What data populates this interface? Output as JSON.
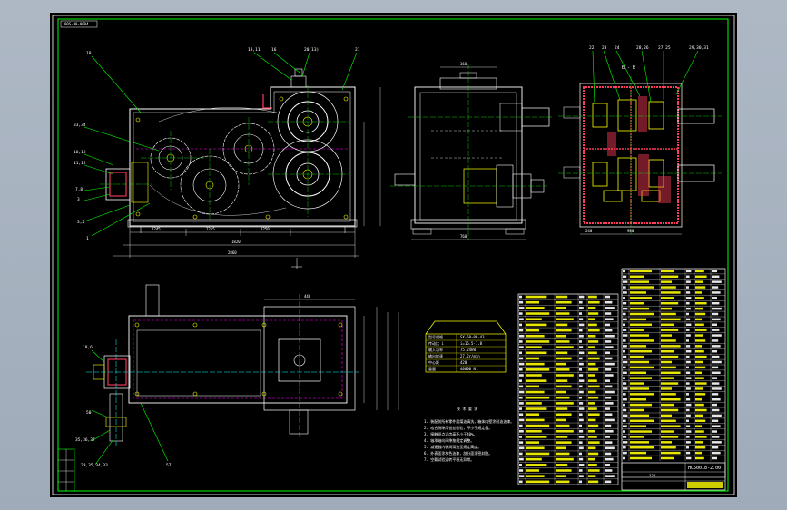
{
  "drawing": {
    "drawing_number": "00S-90-0004",
    "title_block_code": "HC50018-2.00",
    "title_block_extra": "???",
    "accent_color": "#00ff00",
    "detail_color": "#ffff00",
    "axis_color": "#00ffff",
    "section_color": "#ff3b5c",
    "housing_color": "#ff00ff"
  },
  "front_view": {
    "callouts": [
      "18",
      "33,34",
      "10,12",
      "11,12",
      "7,8",
      "3",
      "1",
      "3,2",
      "18,11",
      "16",
      "20(13)",
      "21"
    ],
    "dims_bottom": [
      "1245",
      "1245",
      "1250",
      "1820",
      "2860"
    ]
  },
  "side_view": {
    "dims": [
      "360",
      "760"
    ]
  },
  "section_view": {
    "title": "B - B",
    "callouts": [
      "22",
      "23",
      "24",
      "28,26",
      "27,25",
      "29,30,31"
    ],
    "dims": [
      "240",
      "980"
    ]
  },
  "plan_view": {
    "callouts": [
      "18,6",
      "50",
      "35,36,37",
      "29,35,34,33",
      "57"
    ],
    "dims": [
      "440"
    ]
  },
  "spec_table": {
    "rows": [
      [
        "型号规格",
        "SX-50-06-43"
      ],
      [
        "传动比 i",
        "i=16.5·1.8"
      ],
      [
        "输入功率",
        "75.24kW"
      ],
      [
        "输出转速",
        "27.2r/min"
      ],
      [
        "中心距",
        "420"
      ],
      [
        "重量",
        "40000 N"
      ]
    ]
  },
  "tech_notes": {
    "heading": "技 术 要 求",
    "lines": [
      "1. 装配前所有零件用煤油清洗，箱体内壁涂耐油油漆。",
      "2. 啮合侧隙用铅丝检验，不小于规定值。",
      "3. 接触斑点沿齿高不小于40%。",
      "4. 轴承轴向间隙按规定调整。",
      "5. 减速器内装润滑油至规定高度。",
      "6. 外表面涂灰色油漆，剖分面涂密封胶。",
      "7. 空载试验运转平稳无异常。"
    ]
  }
}
